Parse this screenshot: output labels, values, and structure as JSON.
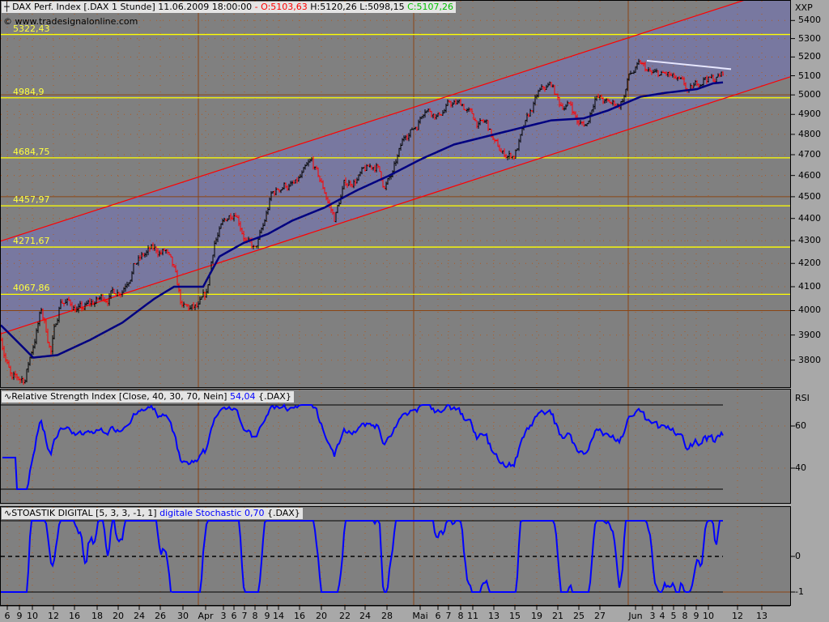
{
  "header": {
    "symbol_icon": "crosshair-icon",
    "title": "DAX Perf. Index [.DAX  1 Stunde]",
    "datetime": "11.06.2009 18:00:00",
    "dash": "-",
    "open": "O:5103,63",
    "high": "H:5120,26",
    "low": "L:5098,15",
    "close": "C:5107,26",
    "copyright": "© www.tradesignalonline.com"
  },
  "colors": {
    "up_bar": "#000000",
    "down_bar": "#ff0000",
    "moving_average": "#000080",
    "channel": "#ff0000",
    "channel_fill": "#7878a0",
    "level_line": "#ffff00",
    "indicator_line": "#0000ff",
    "trendline": "#e8e8ff"
  },
  "rsi": {
    "label": "Relative Strength Index [Close, 40, 30, 70, Nein]",
    "value": "54,04",
    "symbol": "{.DAX}",
    "axis_title": "RSI",
    "ticks": [
      "60",
      "40"
    ]
  },
  "stoch": {
    "label": "STOASTIK DIGITAL [5, 3, 3, -1, 1]",
    "value": "digitale Stochastic 0,70",
    "symbol": "{.DAX}",
    "ticks": [
      "0",
      "-1"
    ]
  },
  "chart_data": {
    "type": "ohlc",
    "title": "DAX Perf. Index 1 Stunde",
    "ylabel": "XXP",
    "yscale": "log",
    "ylim": [
      3700,
      5450
    ],
    "yticks": [
      "5400",
      "5300",
      "5200",
      "5100",
      "5000",
      "4900",
      "4800",
      "4700",
      "4600",
      "4500",
      "4400",
      "4300",
      "4200",
      "4100",
      "4000",
      "3900",
      "3800"
    ],
    "xticks": [
      "6",
      "9",
      "10",
      "12",
      "16",
      "18",
      "20",
      "24",
      "26",
      "30",
      "Apr",
      "3",
      "6",
      "7",
      "8",
      "9",
      "14",
      "16",
      "20",
      "22",
      "24",
      "28",
      "Mai",
      "6",
      "7",
      "8",
      "11",
      "13",
      "15",
      "19",
      "21",
      "25",
      "27",
      "Jun",
      "3",
      "4",
      "5",
      "8",
      "9",
      "10",
      "12",
      "13"
    ],
    "levels": [
      "5322,43",
      "4984,9",
      "4684,75",
      "4457,97",
      "4271,67",
      "4067,86"
    ],
    "level_values": [
      5322.43,
      4984.9,
      4684.75,
      4457.97,
      4271.67,
      4067.86
    ],
    "bar_count": 447,
    "price_path": [
      [
        0,
        3900
      ],
      [
        7,
        3710
      ],
      [
        15,
        3730
      ],
      [
        25,
        4000
      ],
      [
        31,
        3840
      ],
      [
        37,
        4050
      ],
      [
        50,
        4000
      ],
      [
        65,
        4060
      ],
      [
        75,
        4100
      ],
      [
        82,
        4200
      ],
      [
        92,
        4250
      ],
      [
        102,
        4250
      ],
      [
        107,
        4150
      ],
      [
        112,
        4000
      ],
      [
        122,
        4000
      ],
      [
        127,
        4050
      ],
      [
        132,
        4300
      ],
      [
        140,
        4400
      ],
      [
        145,
        4450
      ],
      [
        152,
        4300
      ],
      [
        157,
        4250
      ],
      [
        162,
        4350
      ],
      [
        167,
        4500
      ],
      [
        175,
        4560
      ],
      [
        182,
        4550
      ],
      [
        187,
        4600
      ],
      [
        192,
        4650
      ],
      [
        200,
        4520
      ],
      [
        206,
        4400
      ],
      [
        212,
        4550
      ],
      [
        222,
        4600
      ],
      [
        232,
        4650
      ],
      [
        237,
        4550
      ],
      [
        242,
        4600
      ],
      [
        250,
        4800
      ],
      [
        257,
        4850
      ],
      [
        262,
        4950
      ],
      [
        270,
        4900
      ],
      [
        277,
        4950
      ],
      [
        285,
        4950
      ],
      [
        295,
        4850
      ],
      [
        300,
        4850
      ],
      [
        305,
        4750
      ],
      [
        310,
        4700
      ],
      [
        317,
        4700
      ],
      [
        322,
        4800
      ],
      [
        327,
        4900
      ],
      [
        332,
        5000
      ],
      [
        340,
        5050
      ],
      [
        345,
        4950
      ],
      [
        352,
        4950
      ],
      [
        357,
        4850
      ],
      [
        362,
        4850
      ],
      [
        367,
        5000
      ],
      [
        375,
        4950
      ],
      [
        382,
        4950
      ],
      [
        385,
        5000
      ],
      [
        388,
        5100
      ],
      [
        395,
        5150
      ],
      [
        402,
        5100
      ],
      [
        412,
        5100
      ],
      [
        420,
        5050
      ],
      [
        425,
        5000
      ],
      [
        430,
        5050
      ],
      [
        435,
        5100
      ],
      [
        440,
        5080
      ],
      [
        446,
        5107
      ]
    ],
    "moving_average": [
      [
        0,
        3940
      ],
      [
        20,
        3810
      ],
      [
        35,
        3820
      ],
      [
        55,
        3880
      ],
      [
        75,
        3950
      ],
      [
        95,
        4050
      ],
      [
        107,
        4100
      ],
      [
        125,
        4100
      ],
      [
        135,
        4230
      ],
      [
        150,
        4290
      ],
      [
        165,
        4330
      ],
      [
        180,
        4390
      ],
      [
        200,
        4450
      ],
      [
        220,
        4530
      ],
      [
        240,
        4600
      ],
      [
        260,
        4680
      ],
      [
        280,
        4750
      ],
      [
        300,
        4790
      ],
      [
        320,
        4830
      ],
      [
        340,
        4870
      ],
      [
        360,
        4880
      ],
      [
        375,
        4920
      ],
      [
        395,
        4990
      ],
      [
        410,
        5010
      ],
      [
        430,
        5030
      ],
      [
        440,
        5060
      ],
      [
        446,
        5065
      ]
    ],
    "channel_upper": [
      [
        0,
        4297
      ],
      [
        488,
        5600
      ]
    ],
    "channel_lower": [
      [
        0,
        3904
      ],
      [
        488,
        5094
      ]
    ],
    "trendline": [
      [
        399,
        5180
      ],
      [
        451,
        5135
      ]
    ],
    "last_close": 5107.26
  }
}
